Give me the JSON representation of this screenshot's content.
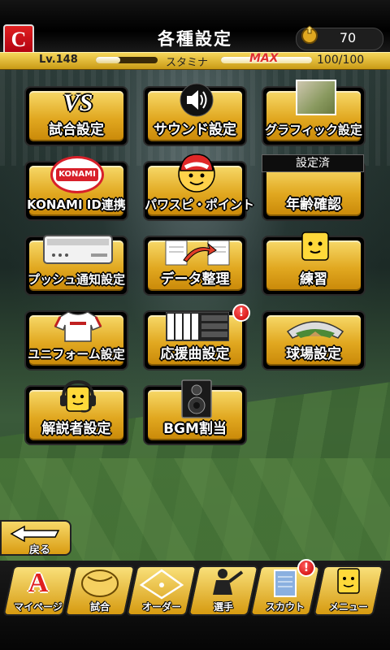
{
  "header": {
    "title": "各種設定",
    "team_logo_letter": "C",
    "coin_count": "70"
  },
  "status": {
    "level": "Lv.148",
    "stamina_label": "スタミナ",
    "stamina_max": "MAX",
    "stamina_value": "100/100",
    "level_progress": 0.4,
    "stamina_progress": 1.0
  },
  "menu": {
    "match_settings": "試合設定",
    "sound_settings": "サウンド設定",
    "graphic_settings": "グラフィック設定",
    "konami_id": "KONAMI ID連携",
    "powaspi_point": "パワスピ・ポイント",
    "age_check": "年齢確認",
    "age_check_tag": "設定済",
    "push_settings": "プッシュ通知設定",
    "data_organize": "データ整理",
    "practice": "練習",
    "uniform_settings": "ユニフォーム設定",
    "cheer_song_settings": "応援曲設定",
    "stadium_settings": "球場設定",
    "commentator_settings": "解説者設定",
    "bgm_assign": "BGM割当",
    "konami_badge_text": "KONAMI ID",
    "vs_text": "VS",
    "cheer_badge": "!"
  },
  "back": {
    "label": "戻る"
  },
  "nav": {
    "items": [
      {
        "label": "マイページ",
        "icon": "A"
      },
      {
        "label": "試合",
        "icon": "ball-icon"
      },
      {
        "label": "オーダー",
        "icon": "field-icon"
      },
      {
        "label": "選手",
        "icon": "player-icon"
      },
      {
        "label": "スカウト",
        "icon": "scout-icon"
      },
      {
        "label": "メニュー",
        "icon": "menu-icon"
      }
    ],
    "scout_badge": "!"
  },
  "colors": {
    "gold": "#e1a820",
    "red": "#c80000"
  }
}
